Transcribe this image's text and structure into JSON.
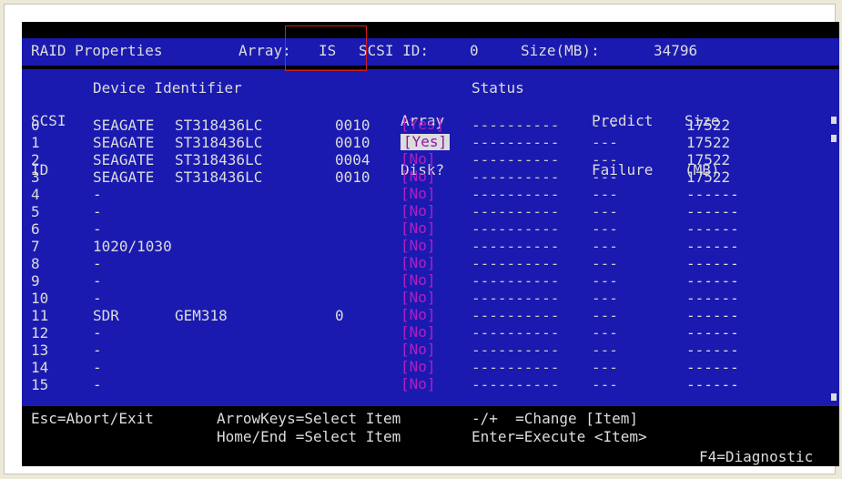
{
  "header": {
    "title": "RAID Properties",
    "array_label": "Array:",
    "array_value": "IS",
    "scsi_label": "SCSI ID:",
    "scsi_value": "0",
    "size_label": "Size(MB):",
    "size_value": "34796"
  },
  "columns": {
    "scsi_id": [
      "SCSI",
      "ID"
    ],
    "device": "Device Identifier",
    "array_disk": [
      "Array",
      "Disk?"
    ],
    "status": "Status",
    "predict": [
      "Predict",
      "Failure"
    ],
    "size": [
      "Size",
      "(MB)"
    ]
  },
  "rows": [
    {
      "id": "0",
      "vendor": "SEAGATE",
      "model": "ST318436LC",
      "rev": "0010",
      "disk": "[Yes]",
      "status": "----------",
      "predict": "---",
      "size": "17522"
    },
    {
      "id": "1",
      "vendor": "SEAGATE",
      "model": "ST318436LC",
      "rev": "0010",
      "disk": "[Yes]",
      "status": "----------",
      "predict": "---",
      "size": "17522"
    },
    {
      "id": "2",
      "vendor": "SEAGATE",
      "model": "ST318436LC",
      "rev": "0004",
      "disk": "[No]",
      "status": "----------",
      "predict": "---",
      "size": "17522"
    },
    {
      "id": "3",
      "vendor": "SEAGATE",
      "model": "ST318436LC",
      "rev": "0010",
      "disk": "[No]",
      "status": "----------",
      "predict": "---",
      "size": "17522"
    },
    {
      "id": "4",
      "vendor": "-",
      "model": "",
      "rev": "",
      "disk": "[No]",
      "status": "----------",
      "predict": "---",
      "size": "------"
    },
    {
      "id": "5",
      "vendor": "-",
      "model": "",
      "rev": "",
      "disk": "[No]",
      "status": "----------",
      "predict": "---",
      "size": "------"
    },
    {
      "id": "6",
      "vendor": "-",
      "model": "",
      "rev": "",
      "disk": "[No]",
      "status": "----------",
      "predict": "---",
      "size": "------"
    },
    {
      "id": "7",
      "vendor": "1020/1030",
      "model": "",
      "rev": "",
      "disk": "[No]",
      "status": "----------",
      "predict": "---",
      "size": "------"
    },
    {
      "id": "8",
      "vendor": "-",
      "model": "",
      "rev": "",
      "disk": "[No]",
      "status": "----------",
      "predict": "---",
      "size": "------"
    },
    {
      "id": "9",
      "vendor": "-",
      "model": "",
      "rev": "",
      "disk": "[No]",
      "status": "----------",
      "predict": "---",
      "size": "------"
    },
    {
      "id": "10",
      "vendor": "-",
      "model": "",
      "rev": "",
      "disk": "[No]",
      "status": "----------",
      "predict": "---",
      "size": "------"
    },
    {
      "id": "11",
      "vendor": "SDR",
      "model": "GEM318",
      "rev": "0",
      "disk": "[No]",
      "status": "----------",
      "predict": "---",
      "size": "------"
    },
    {
      "id": "12",
      "vendor": "-",
      "model": "",
      "rev": "",
      "disk": "[No]",
      "status": "----------",
      "predict": "---",
      "size": "------"
    },
    {
      "id": "13",
      "vendor": "-",
      "model": "",
      "rev": "",
      "disk": "[No]",
      "status": "----------",
      "predict": "---",
      "size": "------"
    },
    {
      "id": "14",
      "vendor": "-",
      "model": "",
      "rev": "",
      "disk": "[No]",
      "status": "----------",
      "predict": "---",
      "size": "------"
    },
    {
      "id": "15",
      "vendor": "-",
      "model": "",
      "rev": "",
      "disk": "[No]",
      "status": "----------",
      "predict": "---",
      "size": "------"
    }
  ],
  "selected_row": 1,
  "footer": {
    "esc": "Esc=Abort/Exit",
    "arrow": "ArrowKeys=Select Item",
    "homeend": "Home/End =Select Item",
    "change": "-/+  =Change [Item]",
    "enter": "Enter=Execute <Item>",
    "f4": "F4=Diagnostic"
  },
  "colors": {
    "panel_bg": "#1a1ab0",
    "text": "#dcdcdc",
    "disk_no": "#b020c0",
    "highlight_border": "#d21e1e"
  }
}
